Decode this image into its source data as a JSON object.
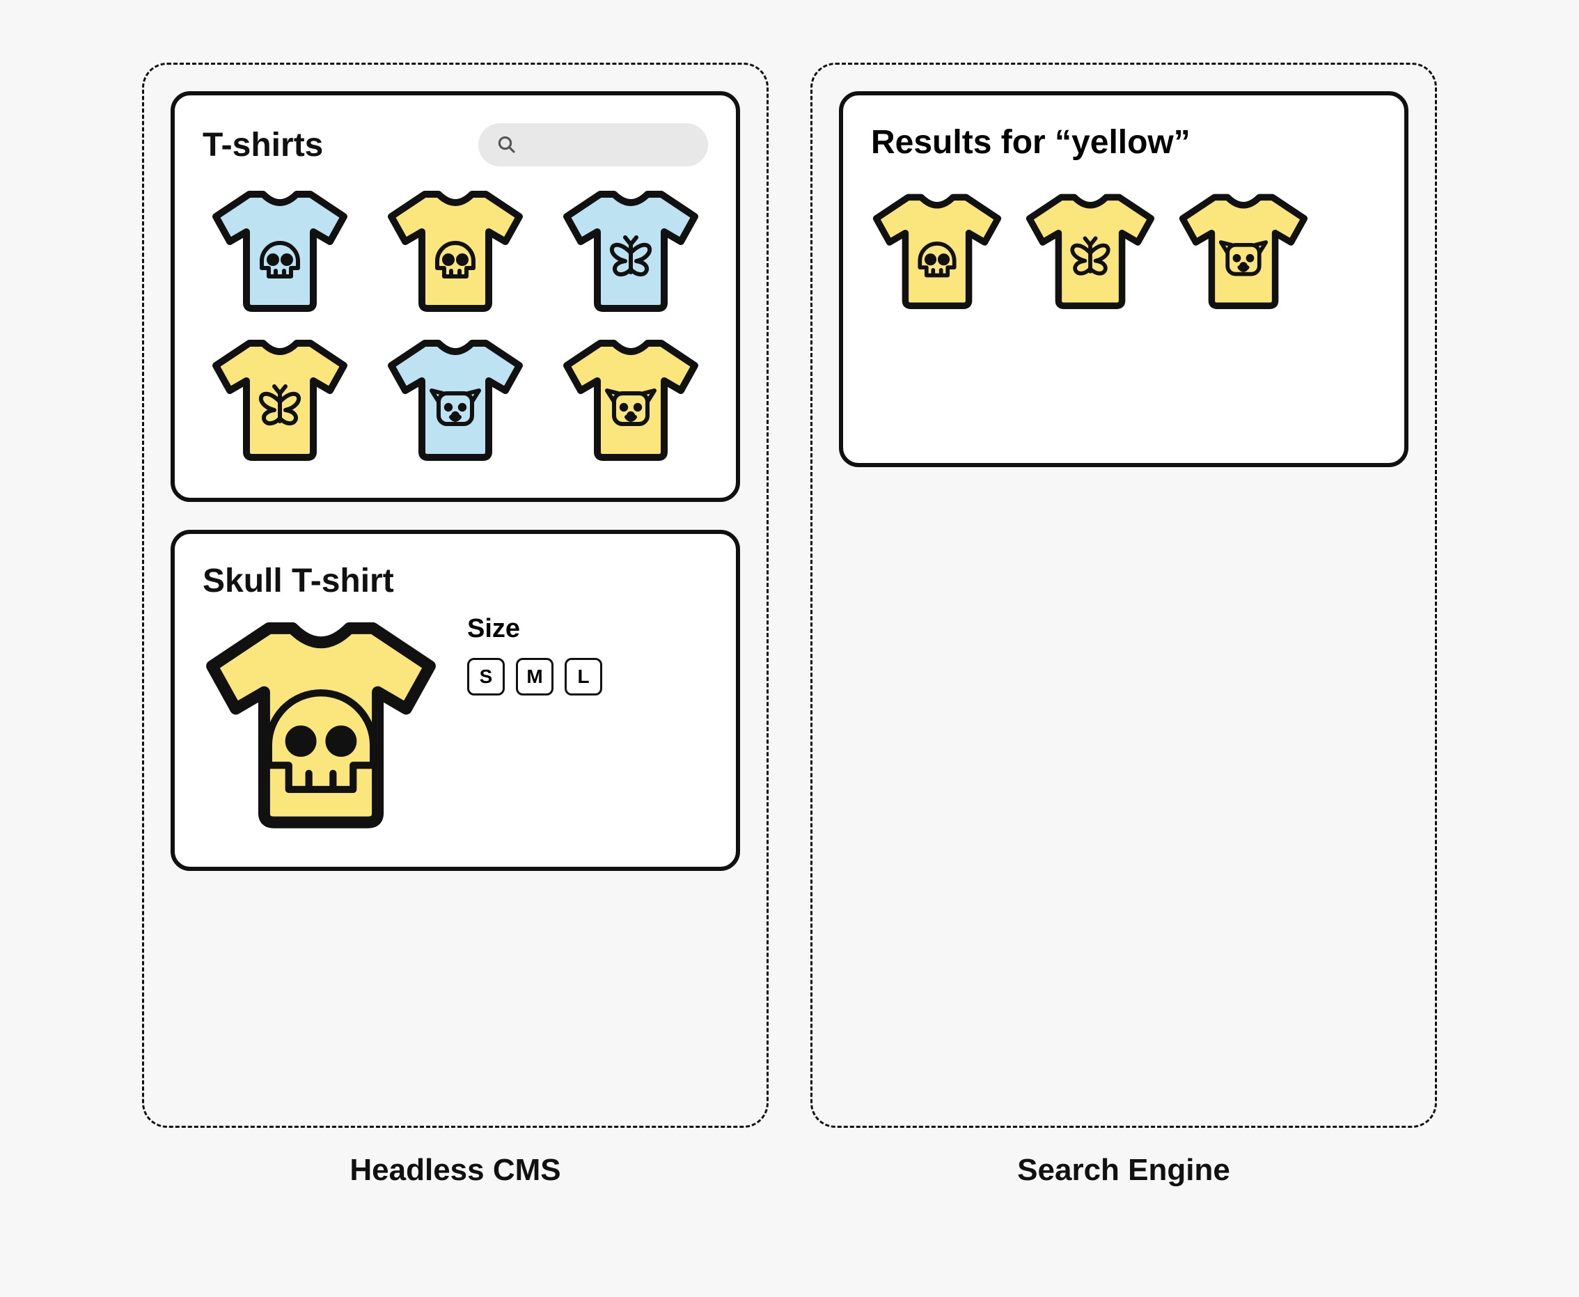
{
  "colors": {
    "yellow": "#FAE67D",
    "blue": "#BDE3F2",
    "stroke": "#111111"
  },
  "cms": {
    "label": "Headless CMS",
    "catalog": {
      "title": "T-shirts",
      "items": [
        {
          "color": "blue",
          "motif": "skull"
        },
        {
          "color": "yellow",
          "motif": "skull"
        },
        {
          "color": "blue",
          "motif": "butterfly"
        },
        {
          "color": "yellow",
          "motif": "butterfly"
        },
        {
          "color": "blue",
          "motif": "dog"
        },
        {
          "color": "yellow",
          "motif": "dog"
        }
      ]
    },
    "detail": {
      "title": "Skull T-shirt",
      "shirt": {
        "color": "yellow",
        "motif": "skull"
      },
      "size_label": "Size",
      "sizes": [
        "S",
        "M",
        "L"
      ]
    }
  },
  "search": {
    "label": "Search Engine",
    "results": {
      "title": "Results for “yellow”",
      "items": [
        {
          "color": "yellow",
          "motif": "skull"
        },
        {
          "color": "yellow",
          "motif": "butterfly"
        },
        {
          "color": "yellow",
          "motif": "dog"
        }
      ]
    }
  }
}
